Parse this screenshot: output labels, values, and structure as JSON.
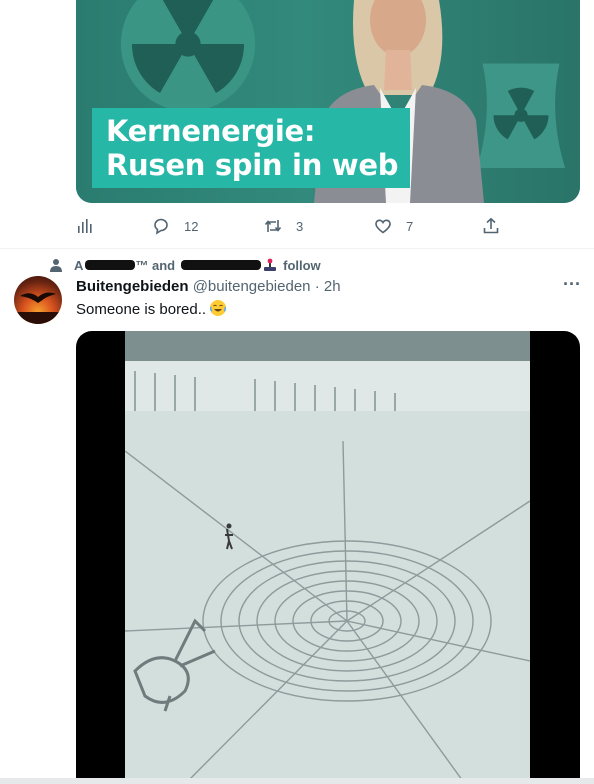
{
  "tweet1": {
    "media_caption_line1": "Kernenergie:",
    "media_caption_line2": "Rusen spin in web",
    "actions": {
      "analytics_icon": "analytics-bar-icon",
      "reply_icon": "speech-bubble-icon",
      "reply_count": "12",
      "retweet_icon": "retweet-arrows-icon",
      "retweet_count": "3",
      "like_icon": "heart-icon",
      "like_count": "7",
      "share_icon": "share-upload-icon"
    }
  },
  "social_context": {
    "icon": "person-icon",
    "name1_partial": "A",
    "tm": "™ and",
    "follow": "follow"
  },
  "tweet2": {
    "display_name": "Buitengebieden",
    "handle": "@buitengebieden",
    "separator": "·",
    "time": "2h",
    "more_icon": "more-dots-icon",
    "more_label": "···",
    "text": "Someone is bored..",
    "emoji": "😂"
  },
  "colors": {
    "teal_caption": "#26b7a6",
    "text_primary": "#0f1419",
    "text_secondary": "#536471"
  }
}
